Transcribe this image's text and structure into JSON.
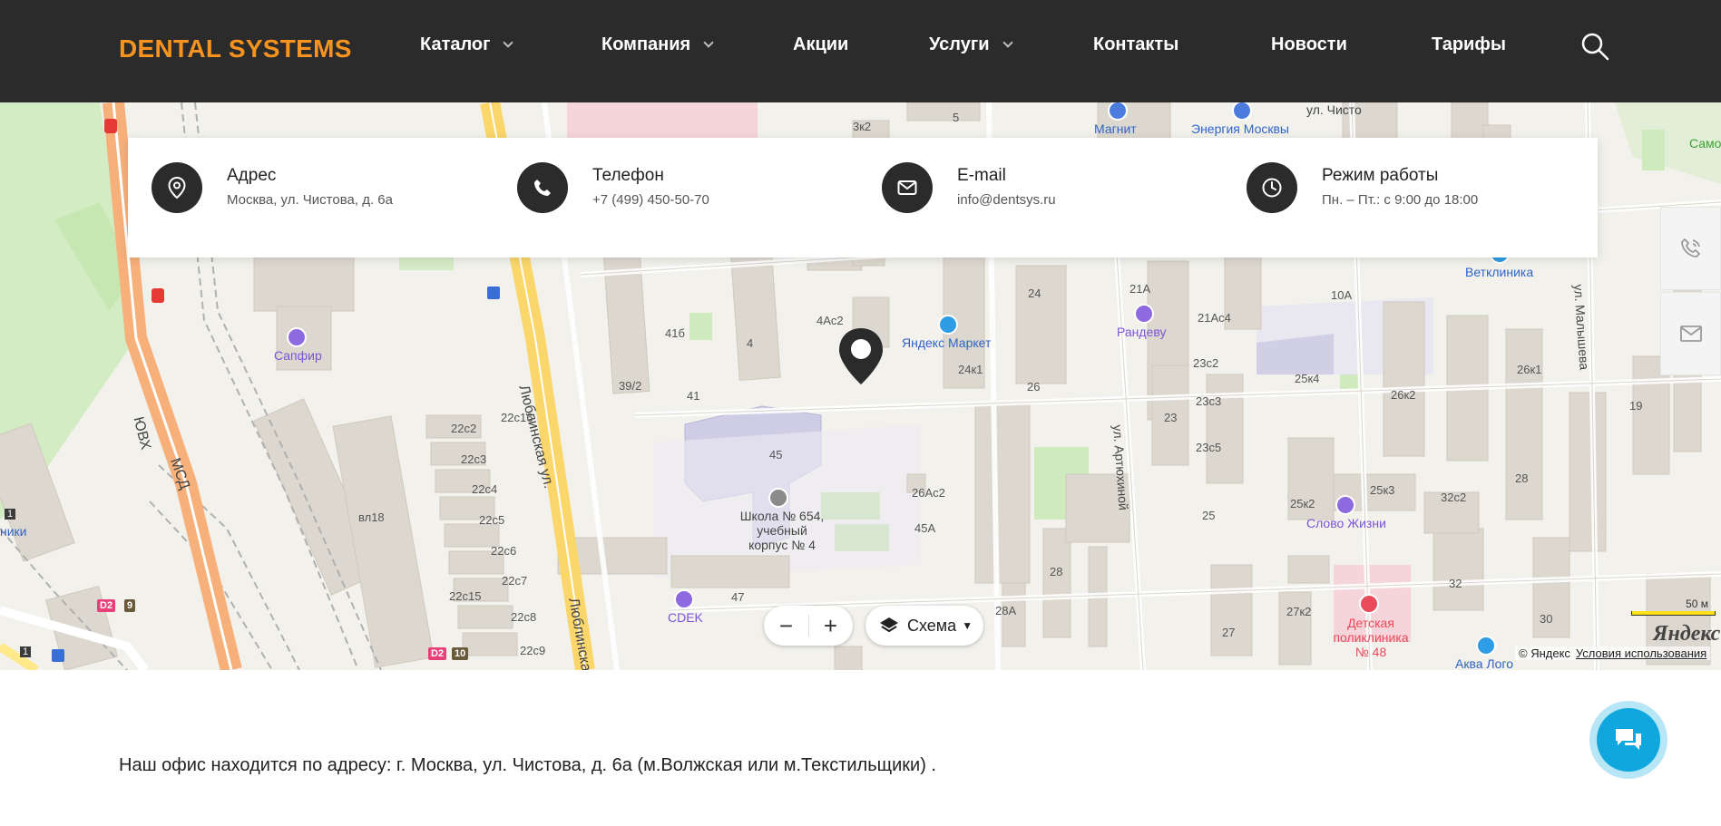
{
  "header": {
    "logo": "DENTAL SYSTEMS",
    "logo_color": "#f7931e",
    "nav": [
      {
        "label": "Каталог",
        "has_dropdown": true
      },
      {
        "label": "Компания",
        "has_dropdown": true
      },
      {
        "label": "Акции",
        "has_dropdown": false
      },
      {
        "label": "Услуги",
        "has_dropdown": true
      },
      {
        "label": "Контакты",
        "has_dropdown": false
      },
      {
        "label": "Новости",
        "has_dropdown": false
      },
      {
        "label": "Тарифы",
        "has_dropdown": false
      }
    ],
    "search_icon": "search-icon"
  },
  "contacts": [
    {
      "icon": "location-pin-icon",
      "title": "Адрес",
      "value": "Москва, ул. Чистова, д. 6а"
    },
    {
      "icon": "phone-icon",
      "title": "Телефон",
      "value": "+7 (499) 450-50-70"
    },
    {
      "icon": "mail-icon",
      "title": "E-mail",
      "value": "info@dentsys.ru"
    },
    {
      "icon": "clock-icon",
      "title": "Режим работы",
      "value": "Пн. – Пт.: с 9:00 до 18:00"
    }
  ],
  "map": {
    "street_labels": [
      "Люблинская ул.",
      "Люблинская",
      "ул. Артюхиной",
      "ул. Малышева",
      "ул. Чисто",
      "ЮВХ",
      "МСД"
    ],
    "building_labels": [
      "41б",
      "41",
      "4",
      "4Ас2",
      "39/2",
      "45",
      "26Ас2",
      "45А",
      "47",
      "24",
      "24к1",
      "26",
      "21А",
      "21Ас4",
      "10А",
      "23с2",
      "23с3",
      "23",
      "23с5",
      "25к4",
      "26к2",
      "26к1",
      "19",
      "28",
      "25к2",
      "25к3",
      "32с2",
      "25",
      "28",
      "32",
      "27к2",
      "27",
      "30",
      "28А",
      "22с2",
      "22с3",
      "22с4",
      "22с5",
      "22с6",
      "22с7",
      "22с8",
      "22с9",
      "22с15",
      "22с16",
      "вл18",
      "3к2",
      "5",
      "1",
      "ники"
    ],
    "pois": [
      {
        "name": "Магнит",
        "icon": "shop-icon"
      },
      {
        "name": "Энергия Москвы",
        "icon": "bus-icon"
      },
      {
        "name": "Яндекс Маркет",
        "icon": "bag-icon"
      },
      {
        "name": "Рандеву",
        "icon": "poi-icon"
      },
      {
        "name": "Ветклиника",
        "icon": "vet-icon"
      },
      {
        "name": "Сапфир",
        "icon": "poi-icon"
      },
      {
        "name": "Школа № 654, учебный корпус № 4",
        "icon": "school-icon"
      },
      {
        "name": "CDEK",
        "icon": "post-icon"
      },
      {
        "name": "Слово Жизни",
        "icon": "poi-icon"
      },
      {
        "name": "Детская поликлиника № 48",
        "icon": "hospital-icon"
      },
      {
        "name": "Аква Лого",
        "icon": "poi-icon"
      },
      {
        "name": "Само",
        "icon": "poi-icon"
      }
    ],
    "metro_badges": [
      "D2",
      "9",
      "D2",
      "10",
      "1"
    ],
    "layer_label": "Схема",
    "scale_label": "50 м",
    "provider_logo": "Яндекс",
    "copyright": "© Яндекс",
    "terms": "Условия использования"
  },
  "office_text": "Наш офис находится по адресу: г. Москва, ул. Чистова, д. 6а (м.Волжская или м.Текстильщики) ."
}
